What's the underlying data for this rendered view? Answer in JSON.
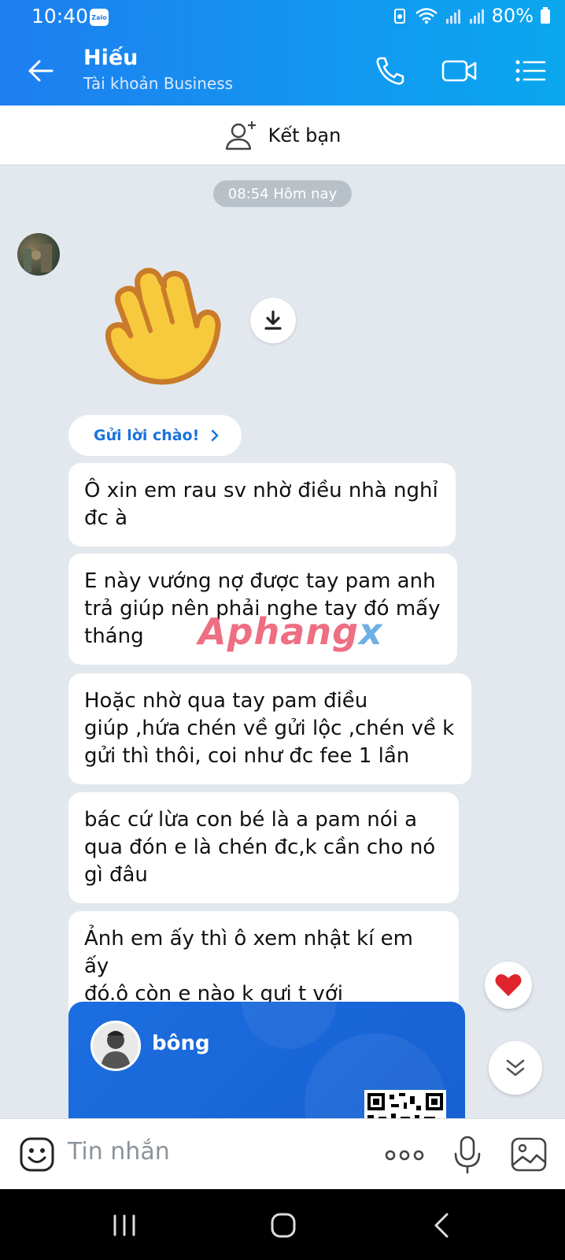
{
  "status": {
    "time": "10:40",
    "app_badge": "Zalo",
    "battery": "80%"
  },
  "header": {
    "title": "Hiếu",
    "subtitle": "Tài khoản Business"
  },
  "add_friend": {
    "label": "Kết bạn"
  },
  "chat": {
    "time_chip": "08:54 Hôm nay",
    "greet_button": "Gửi lời chào!",
    "messages": [
      {
        "lines": [
          "Ô xin em rau sv nhờ điều nhà nghỉ",
          "đc à"
        ]
      },
      {
        "lines": [
          "E này vướng nợ được tay pam anh",
          "trả giúp nên phải nghe tay đó mấy",
          "tháng"
        ]
      },
      {
        "lines": [
          "Hoặc nhờ qua tay pam điều",
          "giúp ,hứa chén về gửi lộc ,chén về k",
          "gửi thì thôi, coi như đc fee 1 lần"
        ]
      },
      {
        "lines": [
          "bác cứ lừa con bé là a pam nói a",
          "qua đón e là chén đc,k cần cho nó",
          "gì đâu"
        ]
      },
      {
        "lines": [
          "Ảnh em ấy thì ô xem nhật kí em ấy",
          "đó.ô còn e nào k gưi t với"
        ]
      }
    ],
    "contact_card": {
      "name": "bông"
    }
  },
  "watermark": {
    "part1": "Aphang",
    "part2": "x"
  },
  "input": {
    "placeholder": "Tin nhắn"
  },
  "colors": {
    "header_start": "#1e7ef0",
    "header_end": "#0aa7ee",
    "chat_bg": "#e2e8ee",
    "accent": "#1a73d9"
  }
}
